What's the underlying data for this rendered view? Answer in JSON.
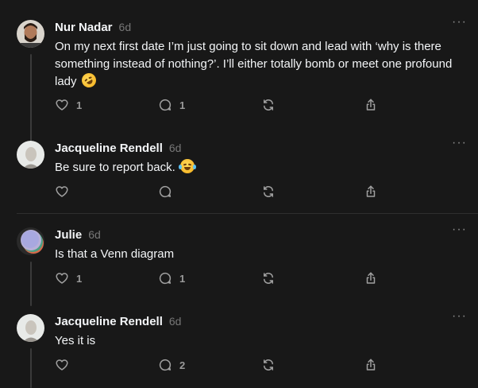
{
  "posts": [
    {
      "username": "Nur Nadar",
      "time": "6d",
      "text": "On my next first date I’m just going to sit down and lead with ‘why is there something instead of nothing?’. I’ll either totally bomb or meet one profound lady",
      "emoji": "rolling-on-floor-laughing",
      "likes": "1",
      "replies": "1",
      "reposts": "",
      "shares": ""
    },
    {
      "username": "Jacqueline Rendell",
      "time": "6d",
      "text": "Be sure to report back.",
      "emoji": "face-with-tears-of-joy",
      "likes": "",
      "replies": "",
      "reposts": "",
      "shares": ""
    },
    {
      "username": "Julie",
      "time": "6d",
      "text": "Is that a Venn diagram",
      "likes": "1",
      "replies": "1",
      "reposts": "",
      "shares": ""
    },
    {
      "username": "Jacqueline Rendell",
      "time": "6d",
      "text": "Yes it is",
      "likes": "",
      "replies": "2",
      "reposts": "",
      "shares": ""
    }
  ],
  "more_label": "···",
  "colors": {
    "background": "#181818",
    "text": "#f3f5f7",
    "muted": "#777777",
    "icon": "#a0a0a0",
    "thread_line": "#3a3a3a"
  }
}
